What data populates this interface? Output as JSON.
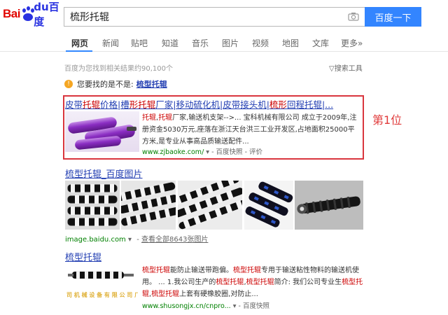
{
  "logo": {
    "left": "Bai",
    "right": "du",
    "brand": "百度"
  },
  "search": {
    "query": "梳形托辊",
    "button_label": "百度一下"
  },
  "tabs": [
    {
      "label": "网页",
      "active": true
    },
    {
      "label": "新闻"
    },
    {
      "label": "贴吧"
    },
    {
      "label": "知道"
    },
    {
      "label": "音乐"
    },
    {
      "label": "图片"
    },
    {
      "label": "视频"
    },
    {
      "label": "地图"
    },
    {
      "label": "文库"
    },
    {
      "label": "更多»"
    }
  ],
  "result_count": "百度为您找到相关结果约90,100个",
  "tools_label": "搜索工具",
  "suggestion": {
    "prefix": "您要找的是不是:",
    "term": "梳型托辊"
  },
  "result1": {
    "title_parts": [
      "皮带",
      "托辊",
      "价格|槽",
      "形",
      "托辊",
      "厂家|移动硫化机|皮带接头机|",
      "梳形",
      "回程托辊|..."
    ],
    "desc_parts": [
      "托辊",
      ",",
      "托辊",
      "厂家,输送机支架-->... 宝科机械有限公司 成立于2009年,注册资金5030万元,座落在浙江天台洪三工业开发区,占地面积25000平方米,是专业从事高品质输送配件..."
    ],
    "url": "www.zjbaoke.com/",
    "snapshot": "百度快照",
    "review": "评价",
    "rank_label": "第1位"
  },
  "result2": {
    "title": "梳型托辊_百度图片",
    "url": "image.baidu.com",
    "more": "查看全部8643张图片"
  },
  "result3": {
    "title": "梳型托辊",
    "desc_parts": [
      "梳型托辊",
      "能防止输送带跑偏。",
      "梳型托辊",
      "专用于输送粘性物料的输送机使用。 ... 1.我公司生产的",
      "梳型托辊",
      ",",
      "梳型托辊",
      "简介: 我们公司专业生",
      "梳型托辊",
      ",",
      "梳型托辊",
      "上套有硬橡胶圈,对防止..."
    ],
    "url": "www.shusongjx.cn/cnpro...",
    "snapshot": "百度快照",
    "watermark": "司 机 械 设 备 有 限 公 司 厂"
  }
}
